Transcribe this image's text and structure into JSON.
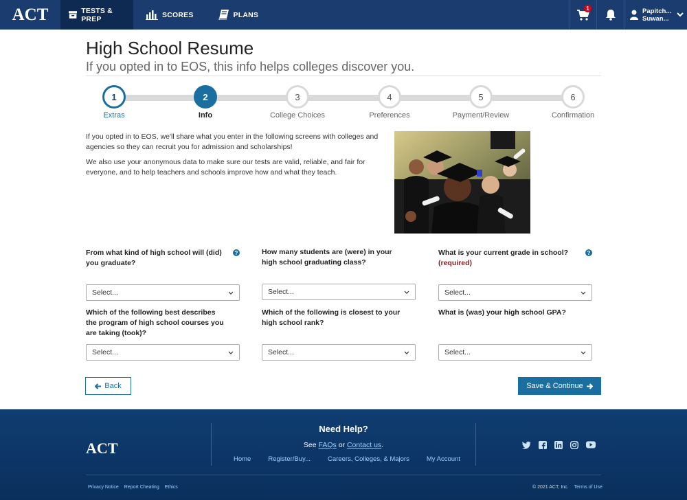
{
  "nav": {
    "logo": "ACT",
    "items": [
      {
        "label": "TESTS & PREP"
      },
      {
        "label": "SCORES"
      },
      {
        "label": "PLANS"
      }
    ],
    "cart_count": "1",
    "user_line1": "Papitch...",
    "user_line2": "Suwan..."
  },
  "header": {
    "title": "High School Resume",
    "subtitle": "If you opted in to EOS, this info helps colleges discover you."
  },
  "steps": [
    {
      "num": "1",
      "label": "Extras",
      "state": "done"
    },
    {
      "num": "2",
      "label": "Info",
      "state": "current"
    },
    {
      "num": "3",
      "label": "College Choices",
      "state": "todo"
    },
    {
      "num": "4",
      "label": "Preferences",
      "state": "todo"
    },
    {
      "num": "5",
      "label": "Payment/Review",
      "state": "todo"
    },
    {
      "num": "6",
      "label": "Confirmation",
      "state": "todo"
    }
  ],
  "intro": {
    "p1": "If you opted in to EOS, we'll share what you enter in the following screens with colleges and agencies so they can recruit you for admission and scholarships!",
    "p2": "We also use your anonymous data to make sure our tests are valid, reliable, and fair for everyone, and to help teachers and schools improve how and what they teach."
  },
  "fields": {
    "school_type": {
      "label": "From what kind of high school will (did) you graduate?",
      "value": "Select..."
    },
    "class_size": {
      "label": "How many students are (were) in your high school graduating class?",
      "value": "Select..."
    },
    "grade": {
      "label": "What is your current grade in school?",
      "required": "(required)",
      "value": "Select..."
    },
    "program": {
      "label": "Which of the following best describes the program of high school courses you are taking (took)?",
      "value": "Select..."
    },
    "rank": {
      "label": "Which of the following is closest to your high school rank?",
      "value": "Select..."
    },
    "gpa": {
      "label": "What is (was) your high school GPA?",
      "value": "Select..."
    }
  },
  "buttons": {
    "back": "Back",
    "save": "Save & Continue"
  },
  "footer": {
    "logo": "ACT",
    "help_title": "Need Help?",
    "see": "See",
    "faqs": "FAQs",
    "or": "or",
    "contact": "Contact us",
    "links": [
      "Home",
      "Register/Buy...",
      "Careers, Colleges, & Majors",
      "My Account"
    ],
    "bottom_links": [
      "Privacy Notice",
      "Report Cheating",
      "Ethics"
    ],
    "copyright": "© 2021 ACT, Inc.",
    "terms": "Terms of Use"
  },
  "colors": {
    "nav_bg": "#1a3c6e",
    "accent": "#1a6fa0",
    "required": "#8b1a1a"
  }
}
